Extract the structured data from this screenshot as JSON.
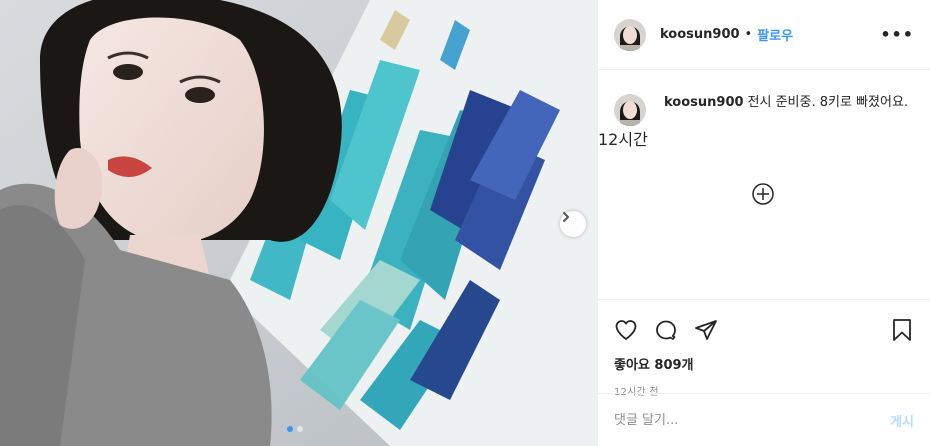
{
  "post": {
    "username": "koosun900",
    "separator": "•",
    "follow_label": "팔로우",
    "more_icon": "more-icon",
    "more_label": "•••"
  },
  "caption": {
    "username": "koosun900",
    "text": "전시 준비중. 8키로 빠졌어요.",
    "time": "12시간"
  },
  "actions": {
    "likes_label": "좋아요",
    "likes_count": "809개",
    "posted_time": "12시간 전"
  },
  "comment_box": {
    "placeholder": "댓글 달기...",
    "post_label": "게시"
  },
  "carousel": {
    "total_slides": 2,
    "current_slide": 1
  },
  "colors": {
    "accent": "#3897f0",
    "post_disabled": "#b2dffc",
    "muted": "#8e8e8e"
  }
}
